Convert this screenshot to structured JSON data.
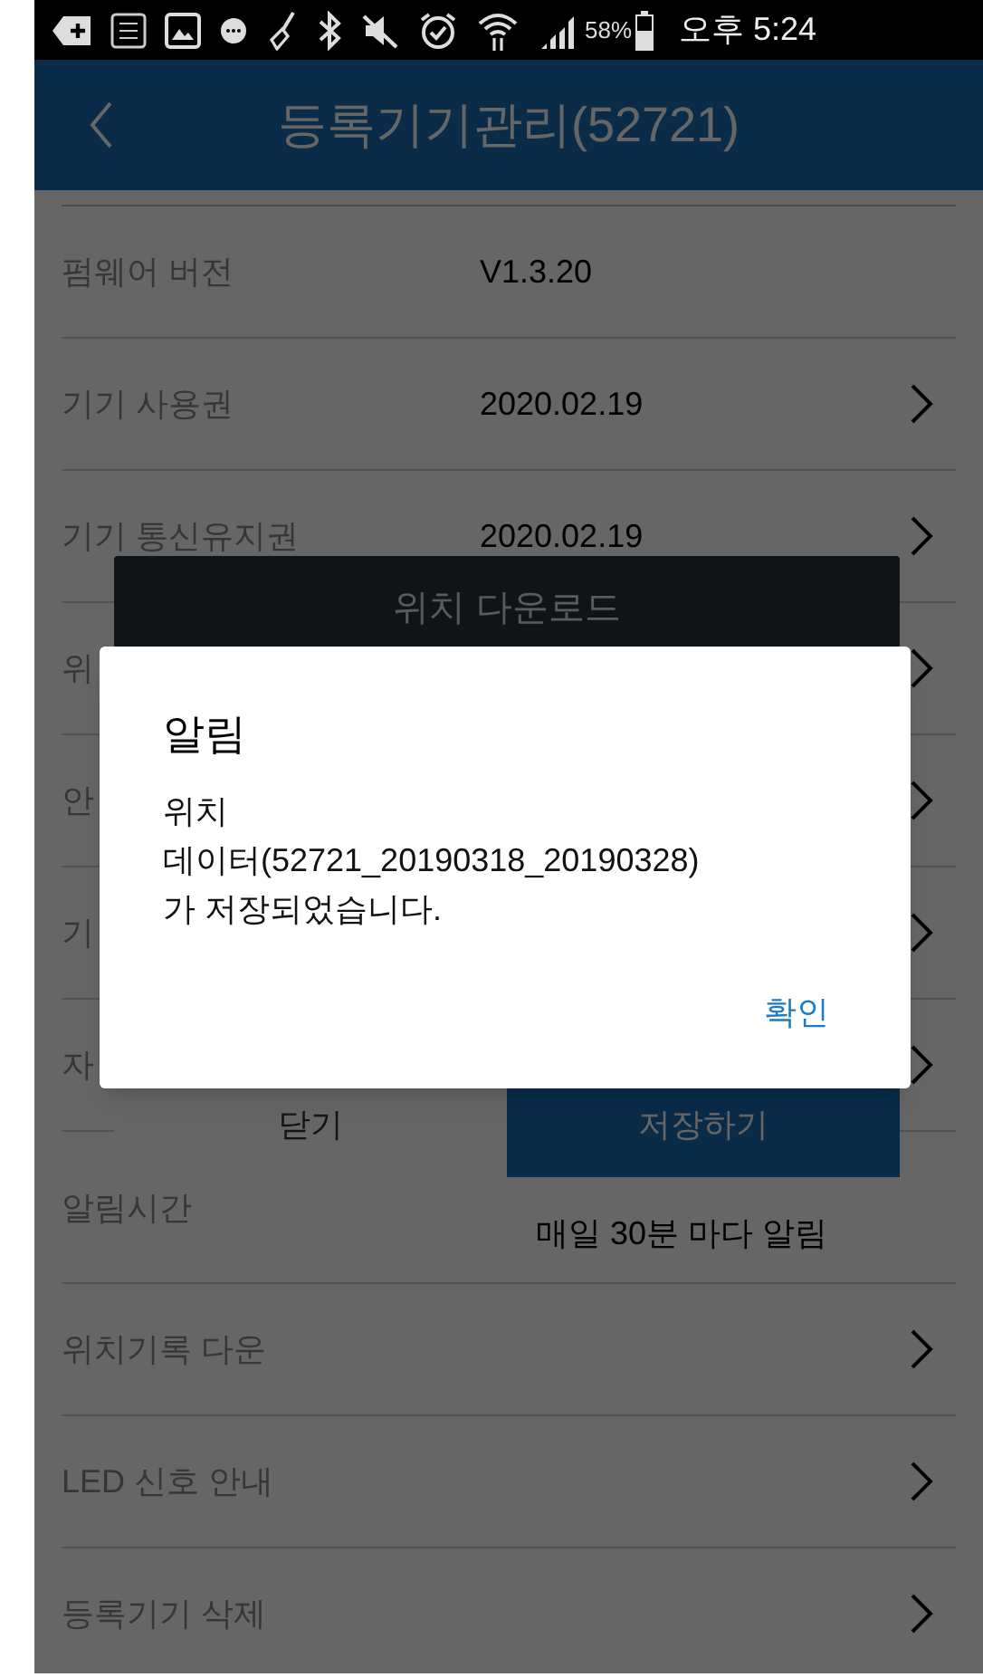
{
  "status_bar": {
    "battery_text": "58%",
    "time": "오후 5:24"
  },
  "header": {
    "title": "등록기기관리(52721)"
  },
  "settings": [
    {
      "label": "펌웨어 버전",
      "value": "V1.3.20",
      "chevron": false,
      "kind": "single"
    },
    {
      "label": "기기 사용권",
      "value": "2020.02.19",
      "chevron": true,
      "kind": "single"
    },
    {
      "label": "기기 통신유지권",
      "value": "2020.02.19",
      "chevron": true,
      "kind": "single"
    },
    {
      "label": "위",
      "chevron": true,
      "kind": "single"
    },
    {
      "label": "안",
      "chevron": true,
      "kind": "single"
    },
    {
      "label": "기",
      "chevron": true,
      "kind": "single"
    },
    {
      "label": "자",
      "chevron": true,
      "kind": "single"
    },
    {
      "label": "알림시간",
      "value": "매일 30분 마다 알림",
      "chevron": false,
      "kind": "tall"
    },
    {
      "label": "위치기록 다운",
      "chevron": true,
      "kind": "single"
    },
    {
      "label": "LED 신호 안내",
      "chevron": true,
      "kind": "single"
    },
    {
      "label": "등록기기 삭제",
      "chevron": true,
      "kind": "single"
    }
  ],
  "download_dialog": {
    "title": "위치 다운로드",
    "buttons": [
      {
        "label": "닫기",
        "kind": "secondary"
      },
      {
        "label": "저장하기",
        "kind": "primary"
      }
    ]
  },
  "alert": {
    "title": "알림",
    "message_lines": [
      "위치",
      "데이터(52721_20190318_20190328)",
      "가 저장되었습니다."
    ],
    "button": "확인"
  }
}
